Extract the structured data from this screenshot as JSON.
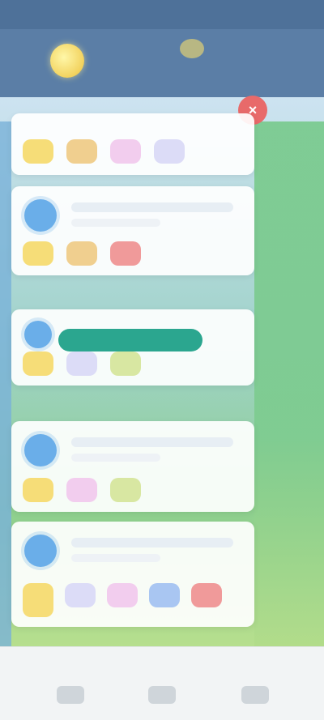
{
  "header": {
    "coin_icon": "coin-icon",
    "badge_icon": "badge-icon"
  },
  "close_button": {
    "label": "×",
    "icon": "close-icon"
  },
  "cards": [
    {
      "title": "",
      "subtitle": "",
      "tokens": [
        "yellow",
        "orange",
        "pink",
        "lavender"
      ]
    },
    {
      "title": "",
      "subtitle": "",
      "tokens": [
        "yellow",
        "orange",
        "red"
      ]
    },
    {
      "title": "",
      "subtitle": "",
      "button_label": "",
      "tokens": [
        "yellow",
        "lavender",
        "green"
      ]
    },
    {
      "title": "",
      "subtitle": "",
      "tokens": [
        "yellow",
        "pink",
        "green"
      ]
    },
    {
      "title": "",
      "subtitle": "",
      "tokens": [
        "yellow",
        "lavender",
        "pink",
        "blue",
        "red"
      ]
    }
  ],
  "bottom_nav": {
    "items": [
      {
        "name": "recent-apps-icon"
      },
      {
        "name": "home-icon"
      },
      {
        "name": "back-icon"
      }
    ]
  },
  "colors": {
    "accent": "#2ba68f",
    "header": "#5b7ea6",
    "close": "#e86a6a"
  }
}
